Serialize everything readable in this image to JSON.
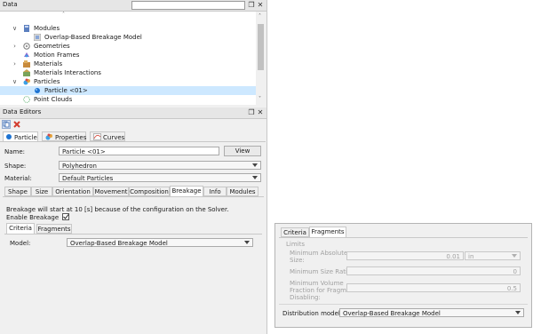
{
  "data_panel": {
    "title": "Data",
    "search_value": "",
    "tree": [
      {
        "label": "Modules",
        "expanded": true,
        "icon": "modules-icon"
      },
      {
        "label": "Overlap-Based Breakage Model",
        "icon": "breakage-model-icon"
      },
      {
        "label": "Geometries",
        "expanded": false,
        "icon": "geometries-icon"
      },
      {
        "label": "Motion Frames",
        "icon": "motion-frames-icon"
      },
      {
        "label": "Materials",
        "expanded": false,
        "icon": "materials-icon"
      },
      {
        "label": "Materials Interactions",
        "icon": "materials-interactions-icon"
      },
      {
        "label": "Particles",
        "expanded": true,
        "icon": "particles-icon"
      },
      {
        "label": "Particle <01>",
        "selected": true,
        "icon": "particle-icon"
      },
      {
        "label": "Point Clouds",
        "icon": "point-clouds-icon"
      }
    ]
  },
  "editors_panel": {
    "title": "Data Editors",
    "top_tabs": [
      "Particle",
      "Properties",
      "Curves"
    ],
    "name_label": "Name:",
    "name_value": "Particle <01>",
    "view_button": "View",
    "shape_label": "Shape:",
    "shape_value": "Polyhedron",
    "material_label": "Material:",
    "material_value": "Default Particles",
    "sub_tabs": [
      "Shape",
      "Size",
      "Orientation",
      "Movement",
      "Composition",
      "Breakage",
      "Info",
      "Modules"
    ],
    "breakage_info": "Breakage will start at 10 [s] because of the configuration on the Solver.",
    "enable_breakage_label": "Enable Breakage",
    "enable_breakage_checked": true,
    "criteria_tabs": [
      "Criteria",
      "Fragments"
    ],
    "model_label": "Model:",
    "model_value": "Overlap-Based Breakage Model"
  },
  "fragments_panel": {
    "tabs": [
      "Criteria",
      "Fragments"
    ],
    "limits_label": "Limits",
    "min_abs_size_label_1": "Minimum Absolute",
    "min_abs_size_label_2": "Size:",
    "min_abs_size_value": "0.01",
    "min_abs_size_unit": "in",
    "min_size_ratio_label": "Minimum Size Ratio:",
    "min_size_ratio_value": "0",
    "min_vol_label_1": "Minimum Volume",
    "min_vol_label_2": "Fraction for Fragment",
    "min_vol_label_3": "Disabling:",
    "min_vol_value": "0.5",
    "distribution_label": "Distribution model:",
    "distribution_value": "Overlap-Based Breakage Model"
  },
  "colors": {
    "selection": "#cde8ff",
    "accent_blue": "#1e73d2",
    "close_red": "#d33a2c"
  }
}
